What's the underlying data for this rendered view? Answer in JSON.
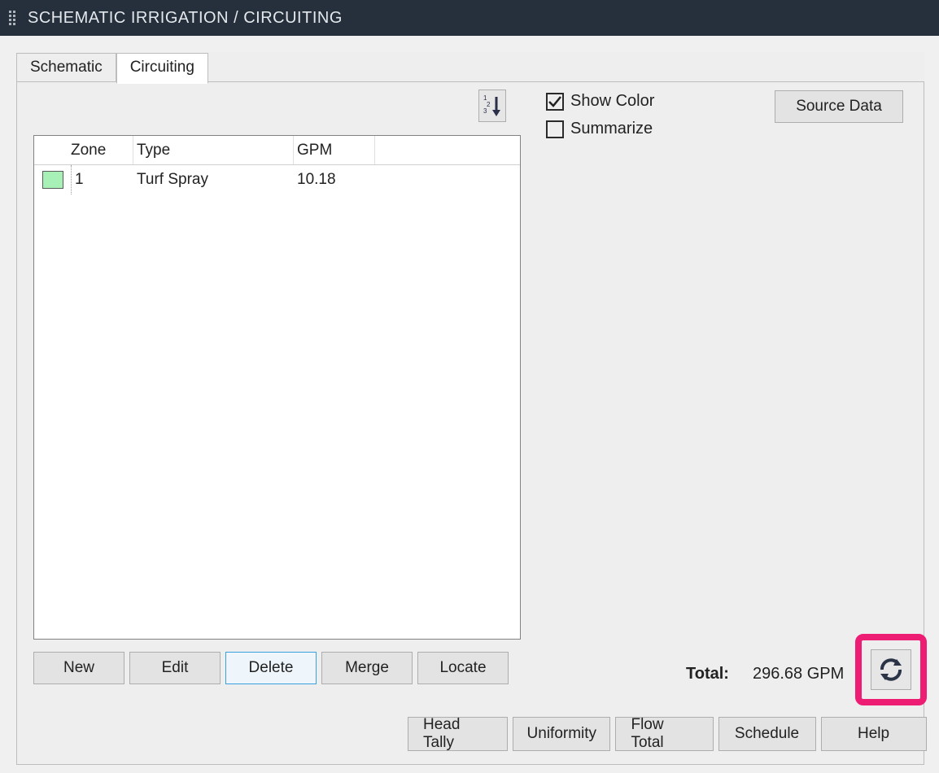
{
  "titlebar": {
    "title": "SCHEMATIC IRRIGATION / CIRCUITING"
  },
  "tabs": {
    "schematic": "Schematic",
    "circuiting": "Circuiting",
    "active": "circuiting"
  },
  "options": {
    "show_color": {
      "label": "Show Color",
      "checked": true
    },
    "summarize": {
      "label": "Summarize",
      "checked": false
    }
  },
  "buttons": {
    "source_data": "Source Data",
    "new": "New",
    "edit": "Edit",
    "delete": "Delete",
    "merge": "Merge",
    "locate": "Locate",
    "head_tally": "Head Tally",
    "uniformity": "Uniformity",
    "flow_total": "Flow Total",
    "schedule": "Schedule",
    "help": "Help"
  },
  "grid": {
    "headers": {
      "zone": "Zone",
      "type": "Type",
      "gpm": "GPM"
    },
    "rows": [
      {
        "color": "#a7f0b6",
        "zone": "1",
        "type": "Turf Spray",
        "gpm": "10.18"
      }
    ]
  },
  "total": {
    "label": "Total:",
    "value": "296.68 GPM"
  },
  "icons": {
    "sort": "sort-numeric-icon",
    "refresh": "refresh-icon"
  }
}
